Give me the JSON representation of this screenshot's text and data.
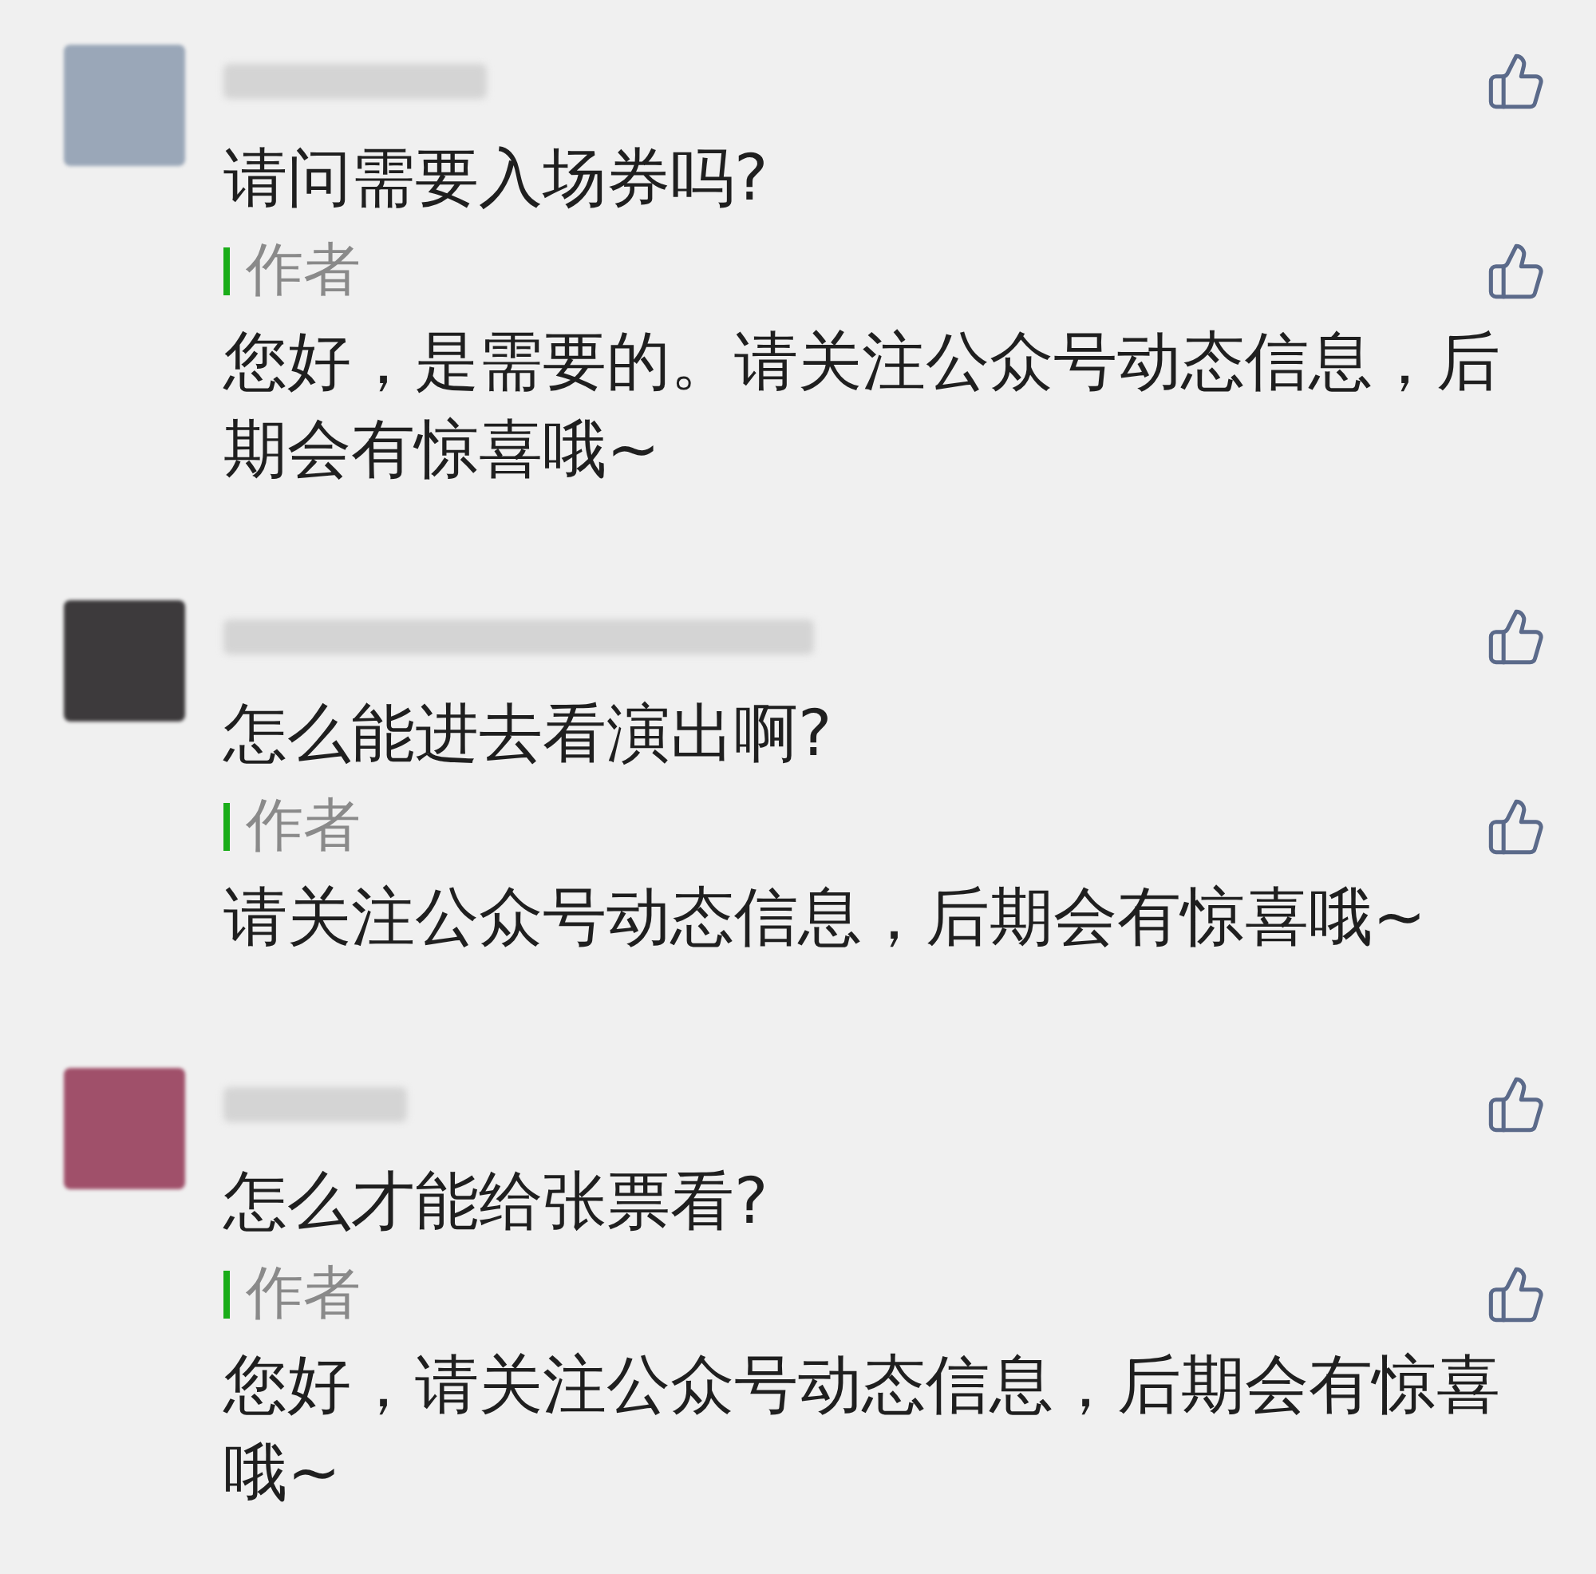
{
  "comments": [
    {
      "text": "请问需要入场券吗?",
      "reply": {
        "author_label": "作者",
        "text": "您好，是需要的。请关注公众号动态信息，后期会有惊喜哦~"
      }
    },
    {
      "text": "怎么能进去看演出啊?",
      "reply": {
        "author_label": "作者",
        "text": "请关注公众号动态信息，后期会有惊喜哦~"
      }
    },
    {
      "text": "怎么才能给张票看?",
      "reply": {
        "author_label": "作者",
        "text": "您好，请关注公众号动态信息，后期会有惊喜哦~"
      }
    }
  ]
}
